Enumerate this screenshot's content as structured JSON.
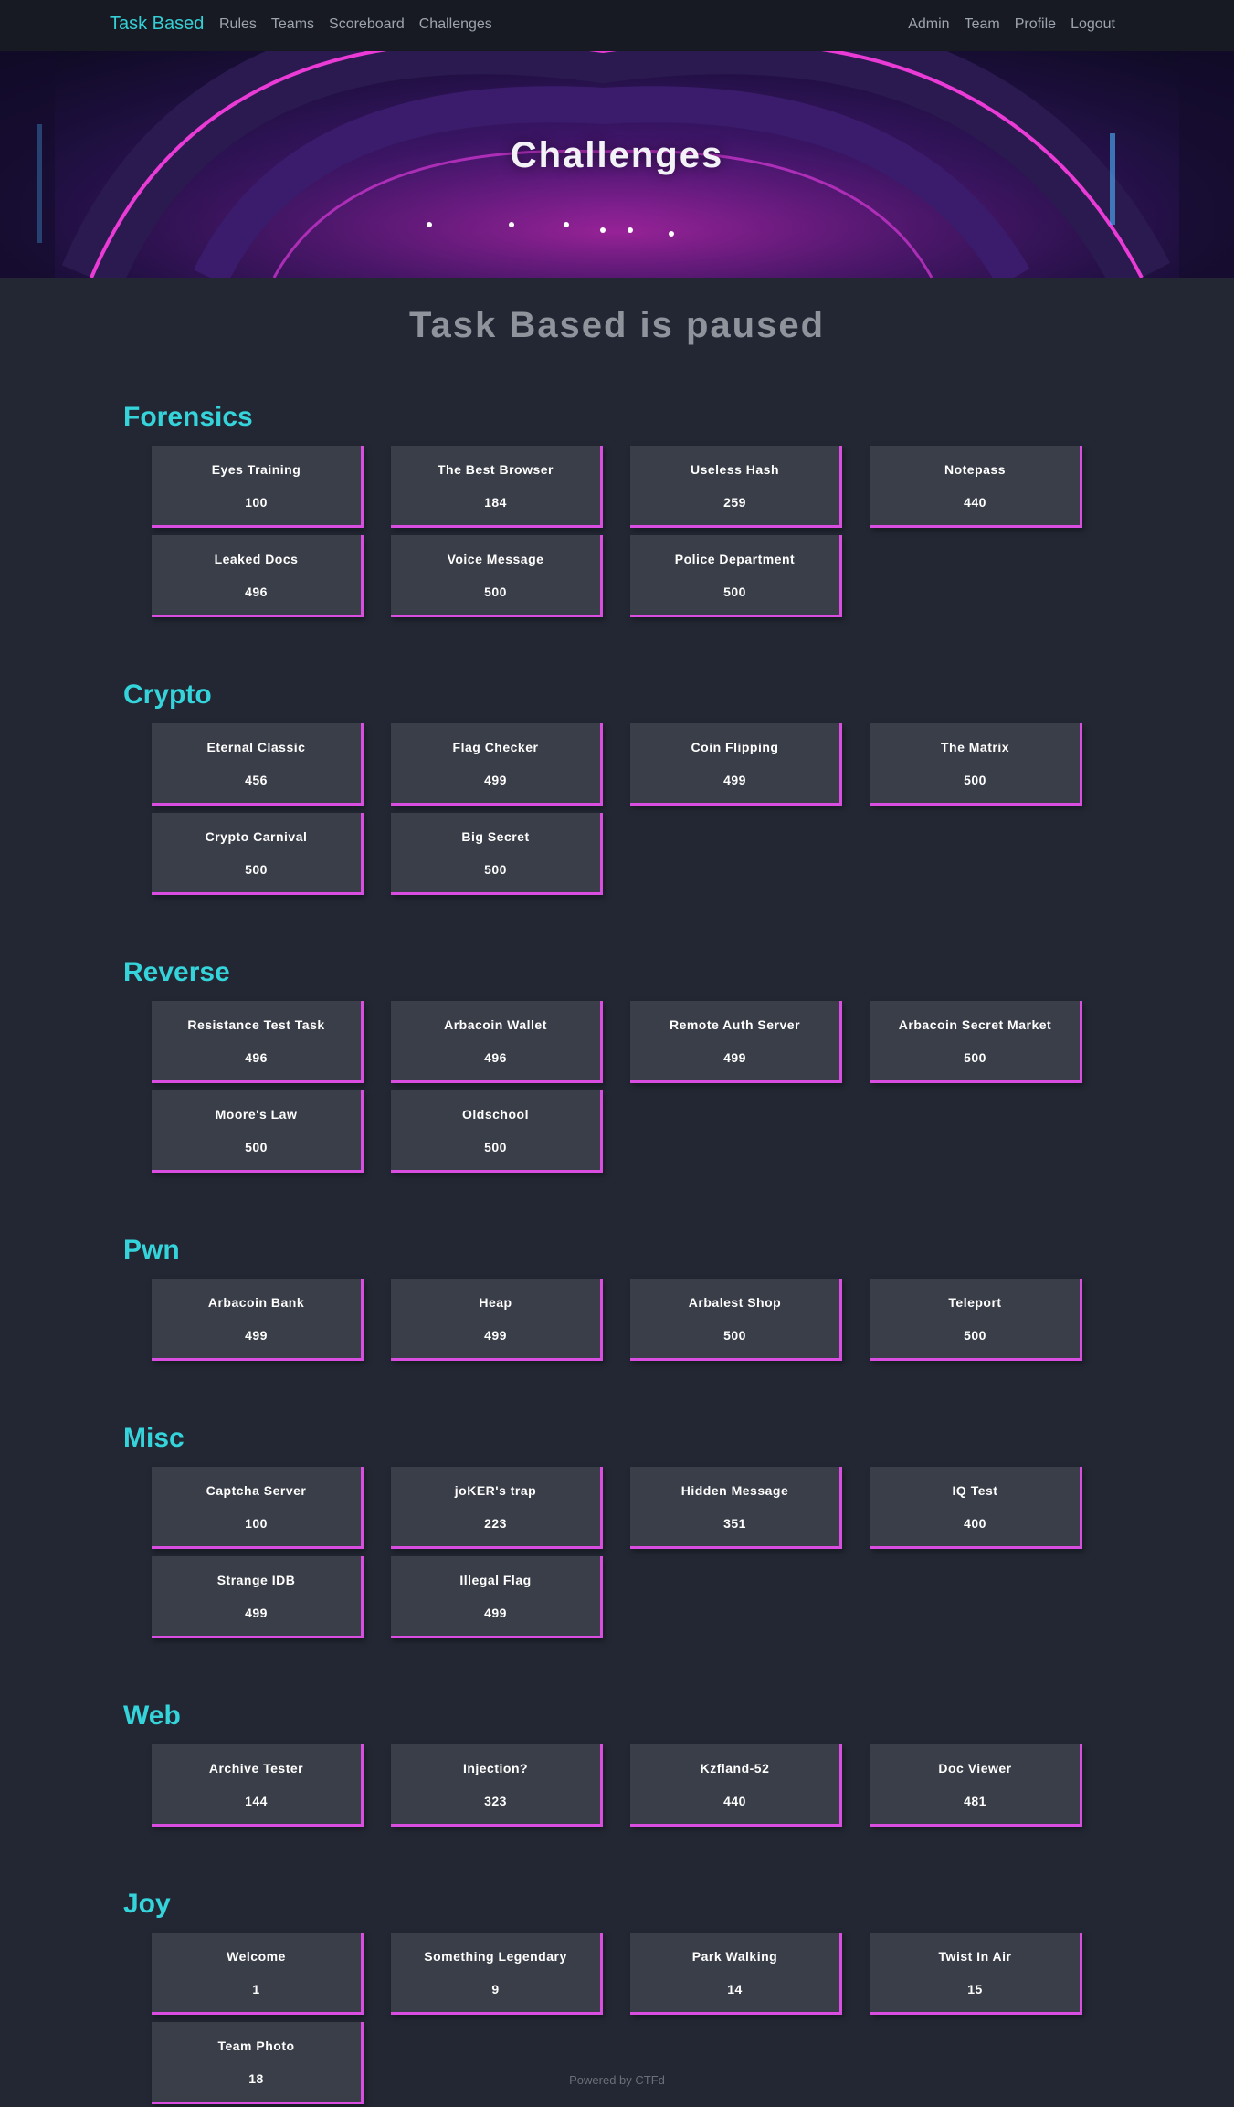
{
  "navbar": {
    "brand": "Task Based",
    "left_links": [
      "Rules",
      "Teams",
      "Scoreboard",
      "Challenges"
    ],
    "right_links": [
      "Admin",
      "Team",
      "Profile",
      "Logout"
    ]
  },
  "hero": {
    "title": "Challenges"
  },
  "status": {
    "paused_text": "Task Based is paused"
  },
  "categories": [
    {
      "name": "Forensics",
      "challenges": [
        {
          "name": "Eyes Training",
          "value": "100"
        },
        {
          "name": "The Best Browser",
          "value": "184"
        },
        {
          "name": "Useless Hash",
          "value": "259"
        },
        {
          "name": "Notepass",
          "value": "440"
        },
        {
          "name": "Leaked Docs",
          "value": "496"
        },
        {
          "name": "Voice Message",
          "value": "500"
        },
        {
          "name": "Police Department",
          "value": "500"
        }
      ]
    },
    {
      "name": "Crypto",
      "challenges": [
        {
          "name": "Eternal Classic",
          "value": "456"
        },
        {
          "name": "Flag Checker",
          "value": "499"
        },
        {
          "name": "Coin Flipping",
          "value": "499"
        },
        {
          "name": "The Matrix",
          "value": "500"
        },
        {
          "name": "Crypto Carnival",
          "value": "500"
        },
        {
          "name": "Big Secret",
          "value": "500"
        }
      ]
    },
    {
      "name": "Reverse",
      "challenges": [
        {
          "name": "Resistance Test Task",
          "value": "496"
        },
        {
          "name": "Arbacoin Wallet",
          "value": "496"
        },
        {
          "name": "Remote Auth Server",
          "value": "499"
        },
        {
          "name": "Arbacoin Secret Market",
          "value": "500"
        },
        {
          "name": "Moore's Law",
          "value": "500"
        },
        {
          "name": "Oldschool",
          "value": "500"
        }
      ]
    },
    {
      "name": "Pwn",
      "challenges": [
        {
          "name": "Arbacoin Bank",
          "value": "499"
        },
        {
          "name": "Heap",
          "value": "499"
        },
        {
          "name": "Arbalest Shop",
          "value": "500"
        },
        {
          "name": "Teleport",
          "value": "500"
        }
      ]
    },
    {
      "name": "Misc",
      "challenges": [
        {
          "name": "Captcha Server",
          "value": "100"
        },
        {
          "name": "joKER's trap",
          "value": "223"
        },
        {
          "name": "Hidden Message",
          "value": "351"
        },
        {
          "name": "IQ Test",
          "value": "400"
        },
        {
          "name": "Strange IDB",
          "value": "499"
        },
        {
          "name": "Illegal Flag",
          "value": "499"
        }
      ]
    },
    {
      "name": "Web",
      "challenges": [
        {
          "name": "Archive Tester",
          "value": "144"
        },
        {
          "name": "Injection?",
          "value": "323"
        },
        {
          "name": "Kzfland-52",
          "value": "440"
        },
        {
          "name": "Doc Viewer",
          "value": "481"
        }
      ]
    },
    {
      "name": "Joy",
      "challenges": [
        {
          "name": "Welcome",
          "value": "1"
        },
        {
          "name": "Something Legendary",
          "value": "9"
        },
        {
          "name": "Park Walking",
          "value": "14"
        },
        {
          "name": "Twist In Air",
          "value": "15"
        },
        {
          "name": "Team Photo",
          "value": "18"
        }
      ]
    }
  ],
  "footer": {
    "text": "Powered by CTFd"
  },
  "colors": {
    "accent": "#35d4db",
    "card_border": "#d94de0",
    "card_bg": "#3a3e48",
    "page_bg": "#222733"
  }
}
